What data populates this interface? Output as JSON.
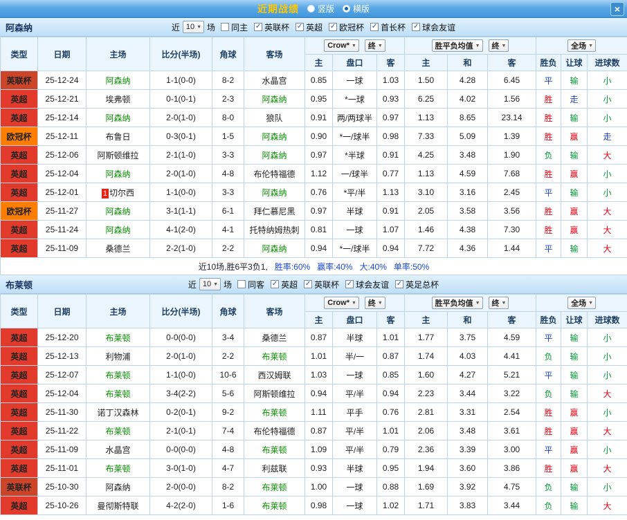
{
  "titlebar": {
    "title": "近期战绩",
    "layout_options": [
      {
        "label": "竖版",
        "selected": false
      },
      {
        "label": "横版",
        "selected": true
      }
    ],
    "close_glyph": "×"
  },
  "table_header": {
    "type": "类型",
    "date": "日期",
    "home": "主场",
    "score": "比分(半场)",
    "corner": "角球",
    "away": "客场",
    "bookmaker": "Crow*",
    "final": "终",
    "wdl_avg": "胜平负均值",
    "full_match": "全场",
    "home_short": "主",
    "handicap": "盘口",
    "away_short": "客",
    "draw_short": "和",
    "win_lose": "胜负",
    "let_ball": "让球",
    "goals": "进球数"
  },
  "glyphs": {
    "check": "✓"
  },
  "colors": {
    "title_text": "#ffc800",
    "focus_team": "#089000",
    "score_text": "#e83b22",
    "type_colors": {
      "英超": "#e23b2b",
      "英联杯": "#cd4529",
      "欧冠杯": "#ff7e00",
      "英足总杯": "#e23b2b"
    },
    "type_default": "#e23b2b",
    "result_colors": {
      "胜": "#e60012",
      "负": "#009933",
      "平": "#2244cc",
      "赢": "#e60012",
      "输": "#009933",
      "走": "#2244cc",
      "大": "#e60012",
      "小": "#009933"
    },
    "stat_text": "#1a49d8"
  },
  "sections": [
    {
      "team": "阿森纳",
      "near_label": "近",
      "count": "10",
      "games_label": "场",
      "filters": [
        {
          "label": "同主",
          "checked": false
        },
        {
          "label": "英联杯",
          "checked": true
        },
        {
          "label": "英超",
          "checked": true
        },
        {
          "label": "欧冠杯",
          "checked": true
        },
        {
          "label": "首长杯",
          "checked": true
        },
        {
          "label": "球会友谊",
          "checked": true
        }
      ],
      "rows": [
        {
          "type": "英联杯",
          "date": "25-12-24",
          "home": "阿森纳",
          "score": "1-1(0-0)",
          "corner": "8-2",
          "away": "水晶宫",
          "odds_home": "0.85",
          "handicap": "一球",
          "odds_away": "1.03",
          "eu_home": "1.50",
          "eu_draw": "4.28",
          "eu_away": "6.45",
          "result": "平",
          "let": "输",
          "goal": "小"
        },
        {
          "type": "英超",
          "date": "25-12-21",
          "home": "埃弗顿",
          "score": "0-1(0-1)",
          "corner": "2-3",
          "away": "阿森纳",
          "odds_home": "0.95",
          "handicap": "*一球",
          "odds_away": "0.93",
          "eu_home": "6.25",
          "eu_draw": "4.02",
          "eu_away": "1.56",
          "result": "胜",
          "let": "走",
          "goal": "小"
        },
        {
          "type": "英超",
          "date": "25-12-14",
          "home": "阿森纳",
          "score": "2-0(1-0)",
          "corner": "8-0",
          "away": "狼队",
          "odds_home": "0.91",
          "handicap": "两/两球半",
          "odds_away": "0.97",
          "eu_home": "1.13",
          "eu_draw": "8.65",
          "eu_away": "23.14",
          "result": "胜",
          "let": "输",
          "goal": "小"
        },
        {
          "type": "欧冠杯",
          "date": "25-12-11",
          "home": "布鲁日",
          "score": "0-3(0-1)",
          "corner": "1-5",
          "away": "阿森纳",
          "odds_home": "0.90",
          "handicap": "*一/球半",
          "odds_away": "0.98",
          "eu_home": "7.33",
          "eu_draw": "5.09",
          "eu_away": "1.39",
          "result": "胜",
          "let": "赢",
          "goal": "走"
        },
        {
          "type": "英超",
          "date": "25-12-06",
          "home": "阿斯顿维拉",
          "score": "2-1(1-0)",
          "corner": "3-3",
          "away": "阿森纳",
          "odds_home": "0.97",
          "handicap": "*半球",
          "odds_away": "0.91",
          "eu_home": "4.25",
          "eu_draw": "3.48",
          "eu_away": "1.90",
          "result": "负",
          "let": "输",
          "goal": "大"
        },
        {
          "type": "英超",
          "date": "25-12-04",
          "home": "阿森纳",
          "score": "2-0(1-0)",
          "corner": "4-8",
          "away": "布伦特福德",
          "odds_home": "1.12",
          "handicap": "一/球半",
          "odds_away": "0.77",
          "eu_home": "1.13",
          "eu_draw": "4.59",
          "eu_away": "7.68",
          "result": "胜",
          "let": "赢",
          "goal": "小"
        },
        {
          "type": "英超",
          "date": "25-12-01",
          "home": "切尔西",
          "home_badge": "1",
          "score": "1-1(0-0)",
          "corner": "3-3",
          "away": "阿森纳",
          "odds_home": "0.76",
          "handicap": "*平/半",
          "odds_away": "1.13",
          "eu_home": "3.10",
          "eu_draw": "3.16",
          "eu_away": "2.45",
          "result": "平",
          "let": "输",
          "goal": "小"
        },
        {
          "type": "欧冠杯",
          "date": "25-11-27",
          "home": "阿森纳",
          "score": "3-1(1-1)",
          "corner": "6-1",
          "away": "拜仁慕尼黑",
          "odds_home": "0.97",
          "handicap": "半球",
          "odds_away": "0.91",
          "eu_home": "2.05",
          "eu_draw": "3.58",
          "eu_away": "3.56",
          "result": "胜",
          "let": "赢",
          "goal": "大"
        },
        {
          "type": "英超",
          "date": "25-11-24",
          "home": "阿森纳",
          "score": "4-1(2-0)",
          "corner": "4-1",
          "away": "托特纳姆热刺",
          "odds_home": "0.81",
          "handicap": "一球",
          "odds_away": "1.07",
          "eu_home": "1.46",
          "eu_draw": "4.38",
          "eu_away": "7.30",
          "result": "胜",
          "let": "赢",
          "goal": "大"
        },
        {
          "type": "英超",
          "date": "25-11-09",
          "home": "桑德兰",
          "score": "2-2(1-0)",
          "corner": "2-2",
          "away": "阿森纳",
          "odds_home": "0.94",
          "handicap": "*一/球半",
          "odds_away": "0.94",
          "eu_home": "7.72",
          "eu_draw": "4.36",
          "eu_away": "1.44",
          "result": "平",
          "let": "输",
          "goal": "大"
        }
      ],
      "summary": {
        "prefix": "近10场,胜6平3负1,",
        "stats": [
          "胜率:60%",
          "赢率:40%",
          "大:40%",
          "单率:50%"
        ]
      }
    },
    {
      "team": "布莱顿",
      "near_label": "近",
      "count": "10",
      "games_label": "场",
      "filters": [
        {
          "label": "同客",
          "checked": false
        },
        {
          "label": "英超",
          "checked": true
        },
        {
          "label": "英联杯",
          "checked": true
        },
        {
          "label": "球会友谊",
          "checked": true
        },
        {
          "label": "英足总杯",
          "checked": true
        }
      ],
      "rows": [
        {
          "type": "英超",
          "date": "25-12-20",
          "home": "布莱顿",
          "score": "0-0(0-0)",
          "corner": "3-4",
          "away": "桑德兰",
          "odds_home": "0.87",
          "handicap": "半球",
          "odds_away": "1.01",
          "eu_home": "1.77",
          "eu_draw": "3.75",
          "eu_away": "4.59",
          "result": "平",
          "let": "输",
          "goal": "小"
        },
        {
          "type": "英超",
          "date": "25-12-13",
          "home": "利物浦",
          "score": "2-0(1-0)",
          "corner": "2-2",
          "away": "布莱顿",
          "odds_home": "1.01",
          "handicap": "半/一",
          "odds_away": "0.87",
          "eu_home": "1.74",
          "eu_draw": "4.03",
          "eu_away": "4.41",
          "result": "负",
          "let": "输",
          "goal": "小"
        },
        {
          "type": "英超",
          "date": "25-12-07",
          "home": "布莱顿",
          "score": "1-1(0-0)",
          "corner": "10-6",
          "away": "西汉姆联",
          "odds_home": "1.03",
          "handicap": "一球",
          "odds_away": "0.85",
          "eu_home": "1.60",
          "eu_draw": "4.27",
          "eu_away": "5.21",
          "result": "平",
          "let": "输",
          "goal": "小"
        },
        {
          "type": "英超",
          "date": "25-12-04",
          "home": "布莱顿",
          "score": "3-4(2-2)",
          "corner": "5-6",
          "away": "阿斯顿维拉",
          "odds_home": "0.94",
          "handicap": "平/半",
          "odds_away": "0.94",
          "eu_home": "2.23",
          "eu_draw": "3.44",
          "eu_away": "3.22",
          "result": "负",
          "let": "输",
          "goal": "大"
        },
        {
          "type": "英超",
          "date": "25-11-30",
          "home": "诺丁汉森林",
          "score": "0-2(0-1)",
          "corner": "9-2",
          "away": "布莱顿",
          "odds_home": "1.11",
          "handicap": "平手",
          "odds_away": "0.76",
          "eu_home": "2.81",
          "eu_draw": "3.31",
          "eu_away": "2.54",
          "result": "胜",
          "let": "赢",
          "goal": "小"
        },
        {
          "type": "英超",
          "date": "25-11-22",
          "home": "布莱顿",
          "score": "2-1(0-1)",
          "corner": "7-4",
          "away": "布伦特福德",
          "odds_home": "0.87",
          "handicap": "平/半",
          "odds_away": "1.01",
          "eu_home": "2.06",
          "eu_draw": "3.48",
          "eu_away": "3.61",
          "result": "胜",
          "let": "赢",
          "goal": "大"
        },
        {
          "type": "英超",
          "date": "25-11-09",
          "home": "水晶宫",
          "score": "0-0(0-0)",
          "corner": "4-8",
          "away": "布莱顿",
          "odds_home": "1.09",
          "handicap": "平/半",
          "odds_away": "0.79",
          "eu_home": "2.36",
          "eu_draw": "3.39",
          "eu_away": "3.00",
          "result": "平",
          "let": "赢",
          "goal": "小"
        },
        {
          "type": "英超",
          "date": "25-11-01",
          "home": "布莱顿",
          "score": "3-0(1-0)",
          "corner": "4-7",
          "away": "利兹联",
          "odds_home": "0.93",
          "handicap": "半球",
          "odds_away": "0.95",
          "eu_home": "1.94",
          "eu_draw": "3.60",
          "eu_away": "3.86",
          "result": "胜",
          "let": "赢",
          "goal": "大"
        },
        {
          "type": "英联杯",
          "date": "25-10-30",
          "home": "阿森纳",
          "score": "2-0(0-0)",
          "corner": "8-2",
          "away": "布莱顿",
          "odds_home": "1.00",
          "handicap": "一球",
          "odds_away": "0.88",
          "eu_home": "1.69",
          "eu_draw": "3.92",
          "eu_away": "4.75",
          "result": "负",
          "let": "输",
          "goal": "小"
        },
        {
          "type": "英超",
          "date": "25-10-26",
          "home": "曼彻斯特联",
          "score": "4-2(2-0)",
          "corner": "1-6",
          "away": "布莱顿",
          "odds_home": "0.98",
          "handicap": "一球",
          "odds_away": "1.02",
          "eu_home": "1.71",
          "eu_draw": "3.83",
          "eu_away": "3.44",
          "result": "负",
          "let": "输",
          "goal": "大"
        }
      ]
    }
  ]
}
